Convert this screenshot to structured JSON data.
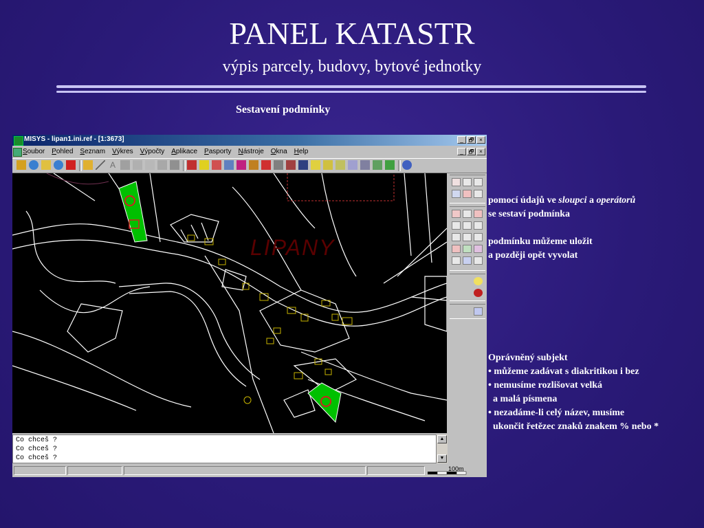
{
  "slide": {
    "title": "PANEL KATASTR",
    "subtitle": "výpis parcely, budovy, bytové jednotky",
    "section_label": "Sestavení podmínky"
  },
  "window": {
    "title": "MISYS - lipan1.ini.ref - [1:3673]",
    "menu": [
      "Soubor",
      "Pohled",
      "Seznam",
      "Výkres",
      "Výpočty",
      "Aplikace",
      "Pasporty",
      "Nástroje",
      "Okna",
      "Help"
    ],
    "buttons": {
      "minimize": "_",
      "restore": "🗗",
      "close": "×"
    }
  },
  "map": {
    "place_label": "LIPANY",
    "scale_label": "100m"
  },
  "command_area": {
    "lines": [
      "Co chceš ?",
      "Co chceš ?",
      "Co chceš ?"
    ]
  },
  "notes": {
    "block1": {
      "line1_a": "pomocí údajů ve ",
      "line1_b": "sloupci",
      "line1_c": " a ",
      "line1_d": "operátorů",
      "line2": "se sestaví podmínka"
    },
    "block2": {
      "line1": "podmínku můžeme uložit",
      "line2": "a později opět vyvolat"
    },
    "block3": {
      "heading": "Oprávněný subjekt",
      "lines": [
        "• můžeme zadávat s diakritikou i bez",
        "• nemusíme rozlišovat velká",
        "  a malá písmena",
        "• nezadáme-li celý název, musíme",
        "  ukončit řetězec znaků znakem % nebo *"
      ]
    }
  },
  "colors": {
    "background": "#2a1a78",
    "parcel_highlight": "#00c000",
    "map_lines": "#ffffff",
    "building_outline": "#c8b400"
  }
}
